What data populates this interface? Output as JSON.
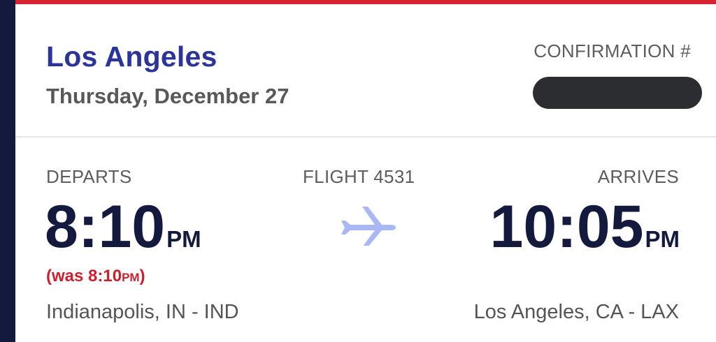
{
  "header": {
    "city": "Los Angeles",
    "date": "Thursday, December 27",
    "confirmation_label": "CONFIRMATION #"
  },
  "flight": {
    "departs_label": "DEPARTS",
    "flight_label": "FLIGHT 4531",
    "arrives_label": "ARRIVES",
    "departure": {
      "time": "8:10",
      "ampm": "PM",
      "was_prefix": "(was 8:10",
      "was_ampm": "PM",
      "was_suffix": ")",
      "place": "Indianapolis, IN - IND"
    },
    "arrival": {
      "time": "10:05",
      "ampm": "PM",
      "place": "Los Angeles, CA - LAX"
    }
  },
  "icons": {
    "plane": "airplane-icon"
  },
  "colors": {
    "accent_red": "#d8222f",
    "navy": "#141a3e",
    "title_blue": "#2a3597",
    "plane_blue": "#a9b8f5",
    "alert_red": "#cf1f2e"
  }
}
